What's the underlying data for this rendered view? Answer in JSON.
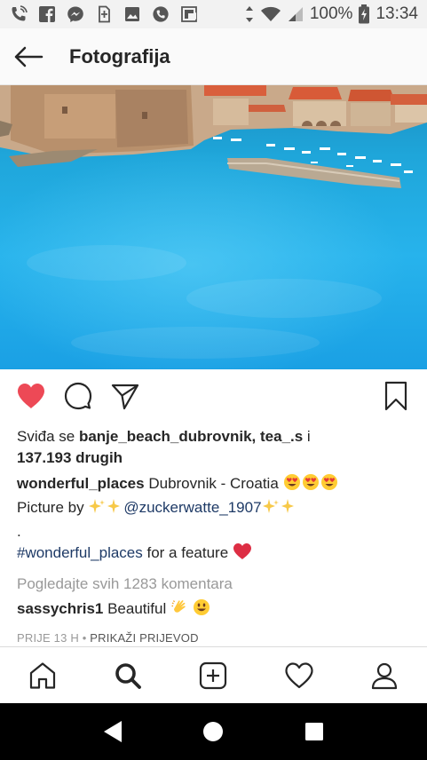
{
  "status_bar": {
    "battery": "100%",
    "time": "13:34",
    "icons": [
      "wifi-calling-icon",
      "facebook-icon",
      "messenger-icon",
      "sim-icon",
      "image-icon",
      "whatsapp-icon",
      "flipboard-icon"
    ]
  },
  "app_bar": {
    "title": "Fotografija"
  },
  "post": {
    "likes_prefix": "Sviđa se ",
    "likes_users": "banje_beach_dubrovnik, tea_.s",
    "likes_and": " i",
    "likes_count": "137.193 drugih",
    "author": "wonderful_places",
    "caption_location": " Dubrovnik - Croatia ",
    "caption_picture_by": "Picture by ",
    "caption_mention": "@zuckerwatte_1907",
    "caption_dot": ".",
    "caption_hashtag": "#wonderful_places",
    "caption_feature": " for a feature ",
    "view_comments": "Pogledajte svih 1283 komentara",
    "comment_user": "sassychris1",
    "comment_text": " Beautiful ",
    "time_ago": "PRIJE 13 H",
    "separator": " • ",
    "translate": "PRIKAŽI PRIJEVOD"
  },
  "colors": {
    "like_red": "#ed4956",
    "link_blue": "#1e3a66",
    "muted_gray": "#999999",
    "status_bg": "#f2f2f2"
  }
}
